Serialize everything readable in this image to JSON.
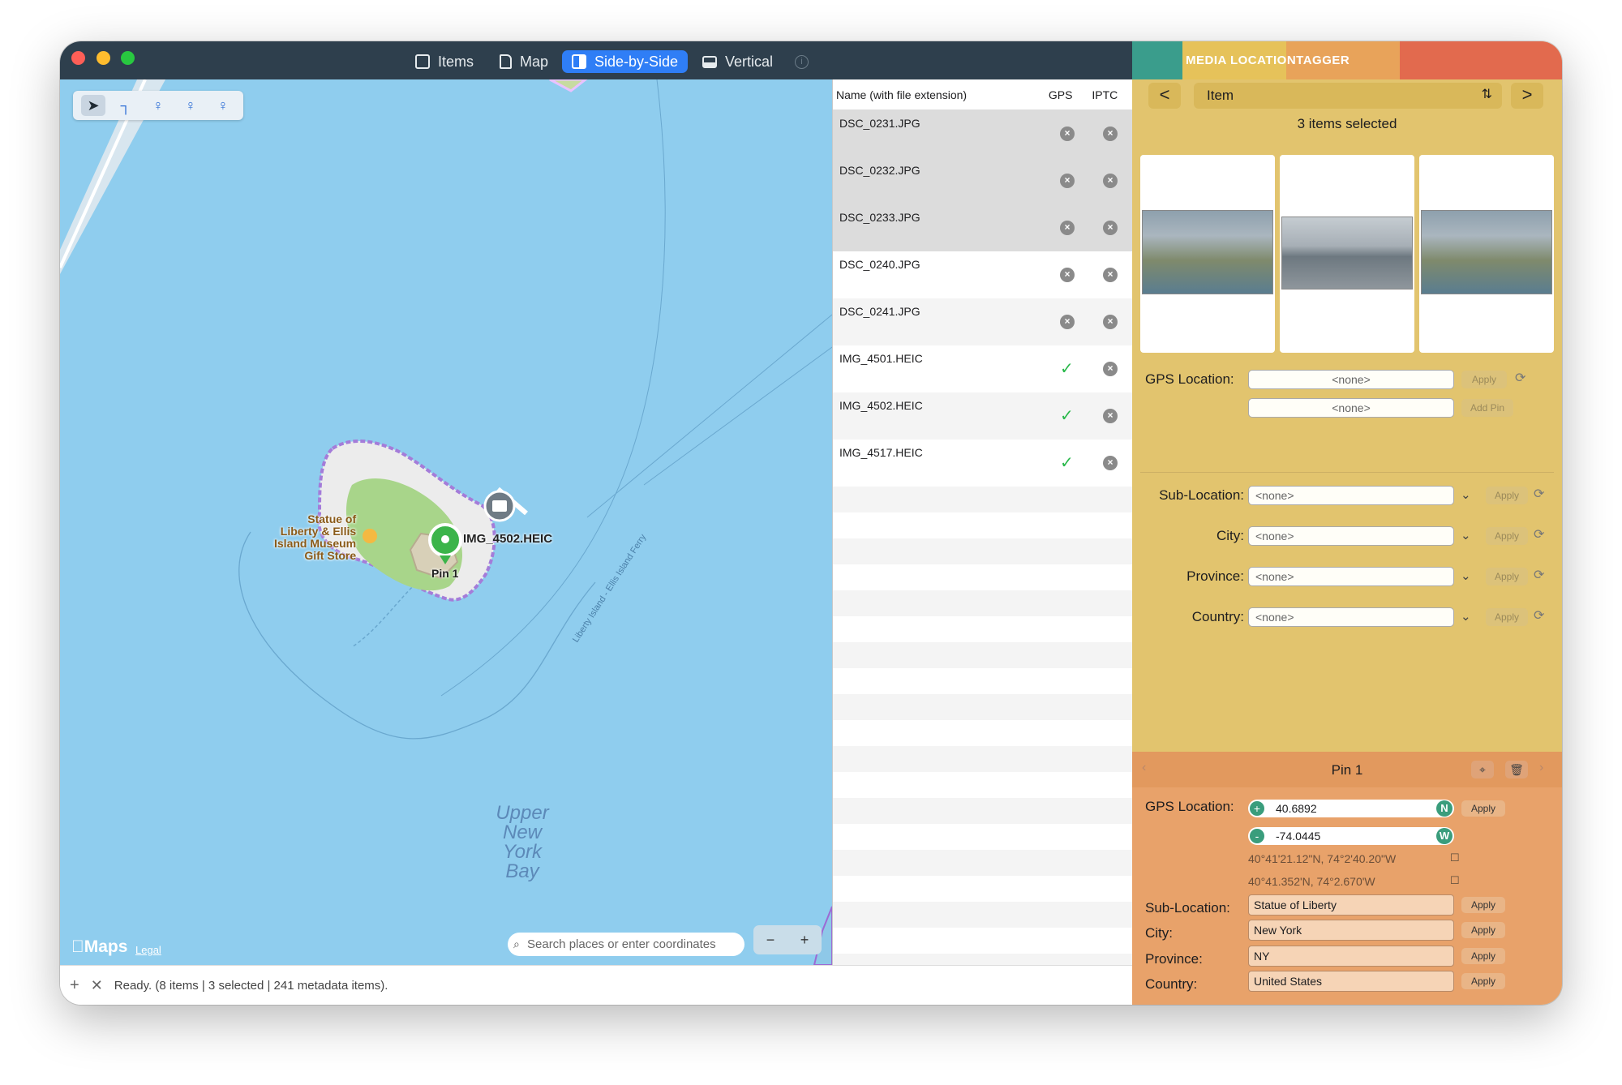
{
  "toolbar": {
    "tabs": [
      {
        "label": "Items",
        "icon": "table-icon",
        "active": false
      },
      {
        "label": "Map",
        "icon": "document-icon",
        "active": false
      },
      {
        "label": "Side-by-Side",
        "icon": "split-view-icon",
        "active": true
      },
      {
        "label": "Vertical",
        "icon": "rows-icon",
        "active": false
      }
    ]
  },
  "map": {
    "poi_label": "Statue of Liberty & Ellis Island Museum Gift Store",
    "poi_lines": [
      "Statue of",
      "Liberty & Ellis",
      "Island Museum",
      "Gift Store"
    ],
    "photo_label": "IMG_4502.HEIC",
    "pin_label": "Pin 1",
    "ferry_label": "Liberty Island - Ellis Island Ferry",
    "water_lines": [
      "Upper",
      "New York",
      "Bay"
    ],
    "maps_logo": "Maps",
    "legal": "Legal",
    "search_placeholder": "Search places or enter coordinates",
    "zoom_out": "−",
    "zoom_in": "+"
  },
  "file_list": {
    "headers": {
      "name": "Name (with file extension)",
      "gps": "GPS",
      "iptc": "IPTC"
    },
    "rows": [
      {
        "name": "DSC_0231.JPG",
        "gps": false,
        "iptc": false,
        "selected": true
      },
      {
        "name": "DSC_0232.JPG",
        "gps": false,
        "iptc": false,
        "selected": true
      },
      {
        "name": "DSC_0233.JPG",
        "gps": false,
        "iptc": false,
        "selected": true
      },
      {
        "name": "DSC_0240.JPG",
        "gps": false,
        "iptc": false,
        "selected": false
      },
      {
        "name": "DSC_0241.JPG",
        "gps": false,
        "iptc": false,
        "selected": false
      },
      {
        "name": "IMG_4501.HEIC",
        "gps": true,
        "iptc": false,
        "selected": false
      },
      {
        "name": "IMG_4502.HEIC",
        "gps": true,
        "iptc": false,
        "selected": false
      },
      {
        "name": "IMG_4517.HEIC",
        "gps": true,
        "iptc": false,
        "selected": false
      }
    ]
  },
  "status": {
    "text": "Ready. (8 items | 3 selected | 241 metadata items)."
  },
  "inspector": {
    "banner_words": [
      "MEDIA",
      "LOCATION",
      "TAGGER"
    ],
    "prev": "<",
    "next": ">",
    "item_select": "Item",
    "selection_count": "3 items selected",
    "gps_label": "GPS Location:",
    "gps_value_1": "<none>",
    "gps_value_2": "<none>",
    "apply": "Apply",
    "add_pin": "Add Pin",
    "fields": [
      {
        "label": "Sub-Location:",
        "value": "<none>"
      },
      {
        "label": "City:",
        "value": "<none>"
      },
      {
        "label": "Province:",
        "value": "<none>"
      },
      {
        "label": "Country:",
        "value": "<none>"
      }
    ]
  },
  "pin": {
    "name": "Pin 1",
    "gps_label": "GPS Location:",
    "lat_sign": "+",
    "lat": "40.6892",
    "lat_hemi": "N",
    "lon_sign": "-",
    "lon": "-74.0445",
    "lon_hemi": "W",
    "dms": "40°41'21.12\"N, 74°2'40.20\"W",
    "ddm": "40°41.352'N, 74°2.670'W",
    "apply": "Apply",
    "fields": [
      {
        "label": "Sub-Location:",
        "value": "Statue of Liberty"
      },
      {
        "label": "City:",
        "value": "New York"
      },
      {
        "label": "Province:",
        "value": "NY"
      },
      {
        "label": "Country:",
        "value": "United States"
      }
    ]
  },
  "colors": {
    "titlebar": "#2e3f4d",
    "accent": "#2f7ef6",
    "water": "#8fcdee",
    "inspector": "#e2c46e",
    "pin_panel": "#e8a26a",
    "banner": [
      "#3a9d8c",
      "#e6c25a",
      "#e8a35a",
      "#e26a4e"
    ]
  }
}
